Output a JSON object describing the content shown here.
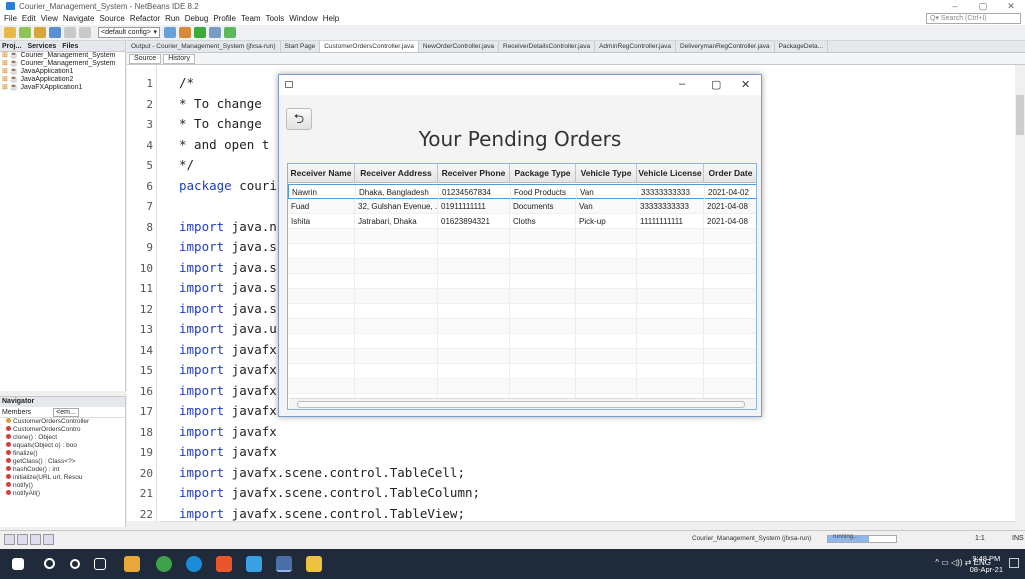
{
  "window_title": "Courier_Management_System - NetBeans IDE 8.2",
  "window_controls": [
    "–",
    "▢",
    "✕"
  ],
  "menu": [
    "File",
    "Edit",
    "View",
    "Navigate",
    "Source",
    "Refactor",
    "Run",
    "Debug",
    "Profile",
    "Team",
    "Tools",
    "Window",
    "Help"
  ],
  "search_placeholder": "Q▾ Search (Ctrl+I)",
  "toolbar": {
    "config": "<default config>"
  },
  "projects": {
    "tabs": [
      "Proj...",
      "Services",
      "Files"
    ],
    "items": [
      "Courier_Management_System",
      "Courier_Management_System",
      "JavaApplication1",
      "JavaApplication2",
      "JavaFXApplication1"
    ]
  },
  "editor_tabs": [
    "Output - Courier_Management_System (jfxsa-run)",
    "Start Page",
    "CustomerOrdersController.java",
    "NewOrderController.java",
    "ReceiverDetailsController.java",
    "AdminRegController.java",
    "DeliverymanRegController.java",
    "PackageDeta..."
  ],
  "editor_toolbar": {
    "source": "Source",
    "history": "History"
  },
  "code_lines": [
    {
      "n": "1",
      "text": "/*",
      "type": "cm"
    },
    {
      "n": "2",
      "text": " * To change",
      "type": "cm"
    },
    {
      "n": "3",
      "text": " * To change",
      "type": "cm"
    },
    {
      "n": "4",
      "text": " * and open t",
      "type": "cm"
    },
    {
      "n": "5",
      "text": " */",
      "type": "cm"
    },
    {
      "n": "6",
      "text": "package couri",
      "type": "pkg"
    },
    {
      "n": "7",
      "text": "",
      "type": "plain"
    },
    {
      "n": "8",
      "text": "import java.n",
      "type": "imp"
    },
    {
      "n": "9",
      "text": "import java.s",
      "type": "imp"
    },
    {
      "n": "10",
      "text": "import java.s",
      "type": "imp"
    },
    {
      "n": "11",
      "text": "import java.s",
      "type": "imp"
    },
    {
      "n": "12",
      "text": "import java.s",
      "type": "imp"
    },
    {
      "n": "13",
      "text": "import java.u",
      "type": "imp"
    },
    {
      "n": "14",
      "text": "import javafx",
      "type": "imp"
    },
    {
      "n": "15",
      "text": "import javafx",
      "type": "imp"
    },
    {
      "n": "16",
      "text": "import javafx",
      "type": "imp"
    },
    {
      "n": "17",
      "text": "import javafx",
      "type": "imp"
    },
    {
      "n": "18",
      "text": "import javafx",
      "type": "imp"
    },
    {
      "n": "19",
      "text": "import javafx",
      "type": "imp"
    },
    {
      "n": "20",
      "text": "import javafx.scene.control.TableCell;",
      "type": "imp"
    },
    {
      "n": "21",
      "text": "import javafx.scene.control.TableColumn;",
      "type": "imp"
    },
    {
      "n": "22",
      "text": "import javafx.scene.control.TableView;",
      "type": "imp"
    },
    {
      "n": "23",
      "text": "import javafx.scene.control.cell.PropertyValueFactory;",
      "type": "imp"
    },
    {
      "n": "24",
      "text": "import javafx.scene.layout.HBox;",
      "type": "imp"
    },
    {
      "n": "25",
      "text": "import javafx.scene.text.Text;",
      "type": "imp"
    }
  ],
  "navigator": {
    "title": "Navigator",
    "members": "Members",
    "filter": "<em...",
    "items": [
      "CustomerOrdersController",
      "CustomerOrdersContro",
      "clone() : Object",
      "equals(Object o) : boo",
      "finalize()",
      "getClass() : Class<?>",
      "hashCode() : int",
      "initialize(URL url, Resou",
      "notify()",
      "notifyAll()"
    ]
  },
  "status": {
    "project": "Courier_Management_System (jfxsa-run)",
    "running": "running...",
    "progress": 0.6,
    "position": "1:1",
    "mode": "INS"
  },
  "taskbar": {
    "time": "9:48 PM",
    "date": "08-Apr-21",
    "lang": "ENG",
    "tray": "^ ▭ ◁)) ⇄"
  },
  "fx_window": {
    "back_icon": "⮌",
    "heading": "Your Pending Orders",
    "columns": [
      "Receiver Name",
      "Receiver Address",
      "Receiver Phone",
      "Package Type",
      "Vehicle Type",
      "Vehicle License",
      "Order Date"
    ],
    "rows": [
      [
        "Nawrin",
        "Dhaka, Bangladesh",
        "01234567834",
        "Food Products",
        "Van",
        "33333333333",
        "2021-04-02"
      ],
      [
        "Fuad",
        "32, Gulshan Evenue, ...",
        "01911111111",
        "Documents",
        "Van",
        "33333333333",
        "2021-04-08"
      ],
      [
        "Ishita",
        "Jatrabari, Dhaka",
        "01623894321",
        "Cloths",
        "Pick-up",
        "11111111111",
        "2021-04-08"
      ]
    ]
  }
}
